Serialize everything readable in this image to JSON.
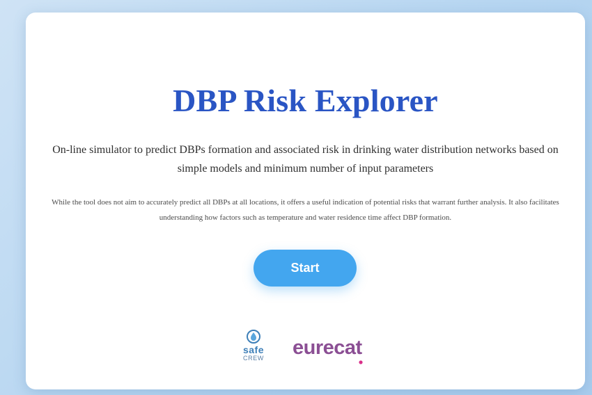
{
  "page": {
    "title": "DBP Risk Explorer",
    "subtitle": "On-line simulator to predict DBPs formation and associated risk in drinking water distribution networks based on simple models and minimum number of input parameters",
    "note": "While the tool does not aim to accurately predict all DBPs at all locations, it offers a useful indication of potential risks that warrant further analysis. It also facilitates understanding how factors such as temperature and water residence time affect DBP formation.",
    "start_label": "Start"
  },
  "logos": {
    "safe_crew": {
      "word": "safe",
      "sub": "CREW"
    },
    "eurecat": {
      "word": "eurecat"
    }
  },
  "colors": {
    "title": "#2a55c4",
    "button": "#43a6ef",
    "eurecat": "#8b4f94",
    "eurecat_accent": "#d9308a",
    "safe": "#3d7fb8",
    "background": "#b7d6f1"
  }
}
